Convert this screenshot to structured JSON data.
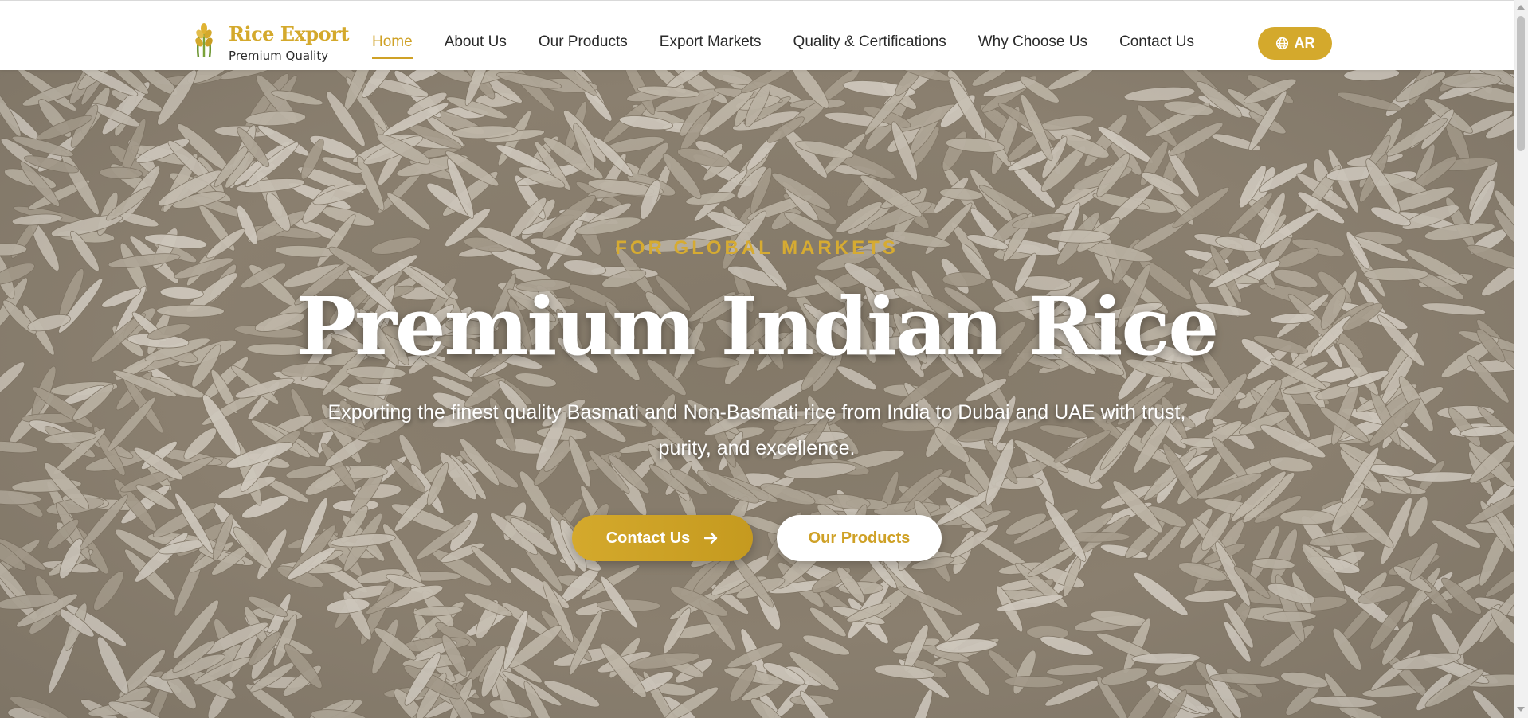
{
  "brand": {
    "title": "Rice Export",
    "subtitle": "Premium Quality",
    "icon": "wheat-icon"
  },
  "nav": {
    "items": [
      {
        "label": "Home",
        "active": true
      },
      {
        "label": "About Us",
        "active": false
      },
      {
        "label": "Our Products",
        "active": false
      },
      {
        "label": "Export Markets",
        "active": false
      },
      {
        "label": "Quality & Certifications",
        "active": false
      },
      {
        "label": "Why Choose Us",
        "active": false
      },
      {
        "label": "Contact Us",
        "active": false
      }
    ],
    "language_label": "AR",
    "language_icon": "globe-icon"
  },
  "hero": {
    "eyebrow": "FOR GLOBAL MARKETS",
    "headline": "Premium Indian Rice",
    "description": "Exporting the finest quality Basmati and Non-Basmati rice from India to Dubai and UAE with trust, purity, and excellence.",
    "primary_cta": "Contact Us",
    "primary_cta_icon": "arrow-right-icon",
    "secondary_cta": "Our Products"
  },
  "colors": {
    "accent": "#d4a92c",
    "nav_text": "#2a2a2a",
    "hero_text": "#ffffff"
  }
}
